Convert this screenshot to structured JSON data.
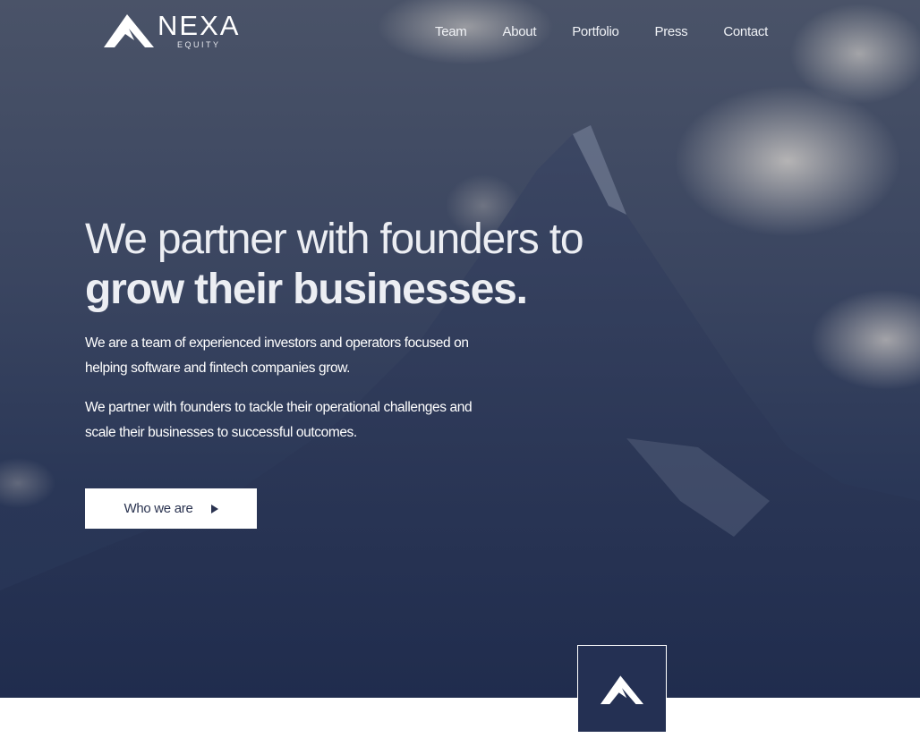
{
  "brand": {
    "name": "NEXA",
    "subtitle": "EQUITY"
  },
  "nav": {
    "items": [
      {
        "label": "Team"
      },
      {
        "label": "About"
      },
      {
        "label": "Portfolio"
      },
      {
        "label": "Press"
      },
      {
        "label": "Contact"
      }
    ]
  },
  "hero": {
    "headline_line1": "We partner with founders to",
    "headline_line2": "grow their businesses.",
    "paragraph1": "We are a team of experienced investors and operators focused on helping software and fintech companies grow.",
    "paragraph2": "We partner with founders to tackle their operational challenges and scale their businesses to successful outcomes.",
    "cta_label": "Who we are"
  },
  "icons": {
    "logo": "mountain-peak-icon",
    "cta_arrow": "play-triangle-icon",
    "badge": "mountain-peak-icon"
  },
  "colors": {
    "navy": "#243053",
    "text_light": "#eceef3",
    "button_bg": "#ffffff",
    "button_text": "#2a3350"
  }
}
